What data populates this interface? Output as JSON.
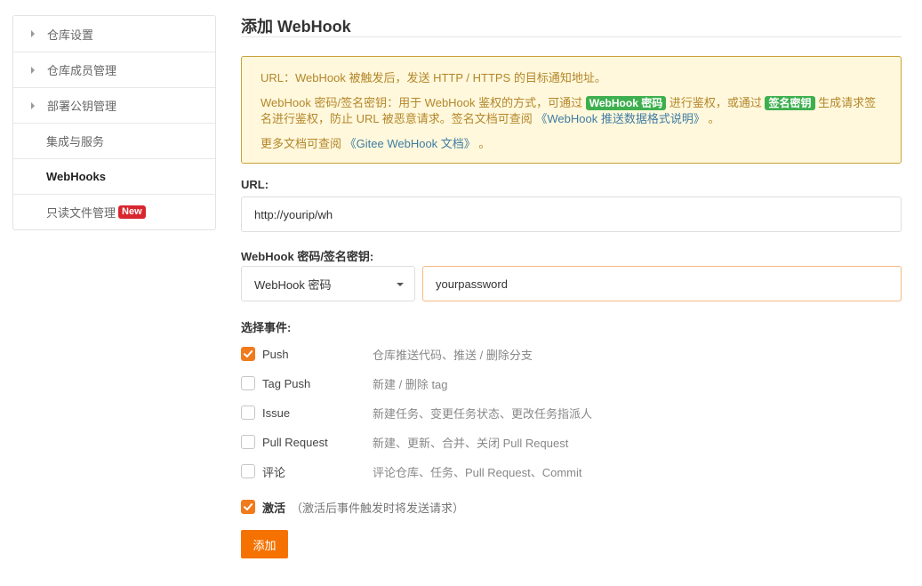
{
  "sidebar": {
    "items": [
      {
        "label": "仓库设置"
      },
      {
        "label": "仓库成员管理"
      },
      {
        "label": "部署公钥管理"
      },
      {
        "label": "集成与服务"
      },
      {
        "label": "WebHooks"
      },
      {
        "label": "只读文件管理",
        "badge": "New"
      }
    ]
  },
  "page": {
    "title": "添加 WebHook"
  },
  "notice": {
    "line1": "URL：WebHook 被触发后，发送 HTTP / HTTPS 的目标通知地址。",
    "line2_a": "WebHook 密码/签名密钥：用于 WebHook 鉴权的方式，可通过",
    "line2_tag1": "WebHook 密码",
    "line2_b": "进行鉴权，或通过",
    "line2_tag2": "签名密钥",
    "line2_c": "生成请求签名进行鉴权，防止 URL 被恶意请求。签名文档可查阅",
    "line2_link": "《WebHook 推送数据格式说明》",
    "line2_d": "。",
    "line3_a": "更多文档可查阅",
    "line3_link": "《Gitee WebHook 文档》",
    "line3_b": "。"
  },
  "form": {
    "url_label": "URL:",
    "url_value": "http://yourip/wh",
    "secret_label": "WebHook 密码/签名密钥:",
    "secret_type": "WebHook 密码",
    "secret_value": "yourpassword",
    "events_label": "选择事件:",
    "events": [
      {
        "name": "Push",
        "desc": "仓库推送代码、推送 / 删除分支",
        "checked": true
      },
      {
        "name": "Tag Push",
        "desc": "新建 / 删除 tag",
        "checked": false
      },
      {
        "name": "Issue",
        "desc": "新建任务、变更任务状态、更改任务指派人",
        "checked": false
      },
      {
        "name": "Pull Request",
        "desc": "新建、更新、合并、关闭 Pull Request",
        "checked": false
      },
      {
        "name": "评论",
        "desc": "评论仓库、任务、Pull Request、Commit",
        "checked": false
      }
    ],
    "activate_label": "激活",
    "activate_hint": "（激活后事件触发时将发送请求）",
    "activate_checked": true,
    "submit_label": "添加"
  },
  "colors": {
    "accent": "#f57200",
    "notice_bg": "#fff8dc",
    "notice_text": "#b3862a",
    "tag_green": "#3eaf4e",
    "badge_red": "#d8262e"
  }
}
